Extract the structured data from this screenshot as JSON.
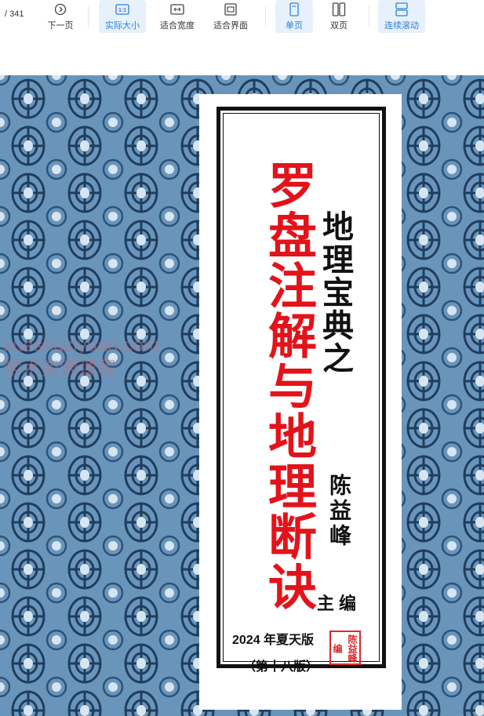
{
  "toolbar": {
    "page_total": "/  341",
    "buttons": [
      {
        "id": "next",
        "label": "下一页",
        "icon": "chevron-right-circle-icon"
      },
      {
        "id": "actual",
        "label": "实际大小",
        "icon": "one-to-one-icon",
        "active": true
      },
      {
        "id": "fit-width",
        "label": "适合宽度",
        "icon": "fit-width-icon"
      },
      {
        "id": "fit-page",
        "label": "适合界面",
        "icon": "fit-page-icon"
      },
      {
        "id": "single",
        "label": "单页",
        "icon": "single-page-icon",
        "active": true
      },
      {
        "id": "double",
        "label": "双页",
        "icon": "double-page-icon"
      },
      {
        "id": "continuous",
        "label": "连续滚动",
        "icon": "continuous-scroll-icon",
        "active": true
      }
    ],
    "accent_color": "#2f7fd6",
    "active_bg": "#e6f1fb"
  },
  "cover": {
    "title": "罗盘注解与地理断诀",
    "subtitle": "地理宝典之",
    "author": "陈益峰",
    "editor_role": "主编",
    "edition": "2024 年夏天版",
    "edition_no": "（第十八版）",
    "seal": "陈益峰编",
    "title_color": "#e3131b",
    "pattern_color": "#4d79a0"
  },
  "watermark": {
    "line1": "xueshuziyuan.com",
    "line2": "学术资源课程"
  }
}
